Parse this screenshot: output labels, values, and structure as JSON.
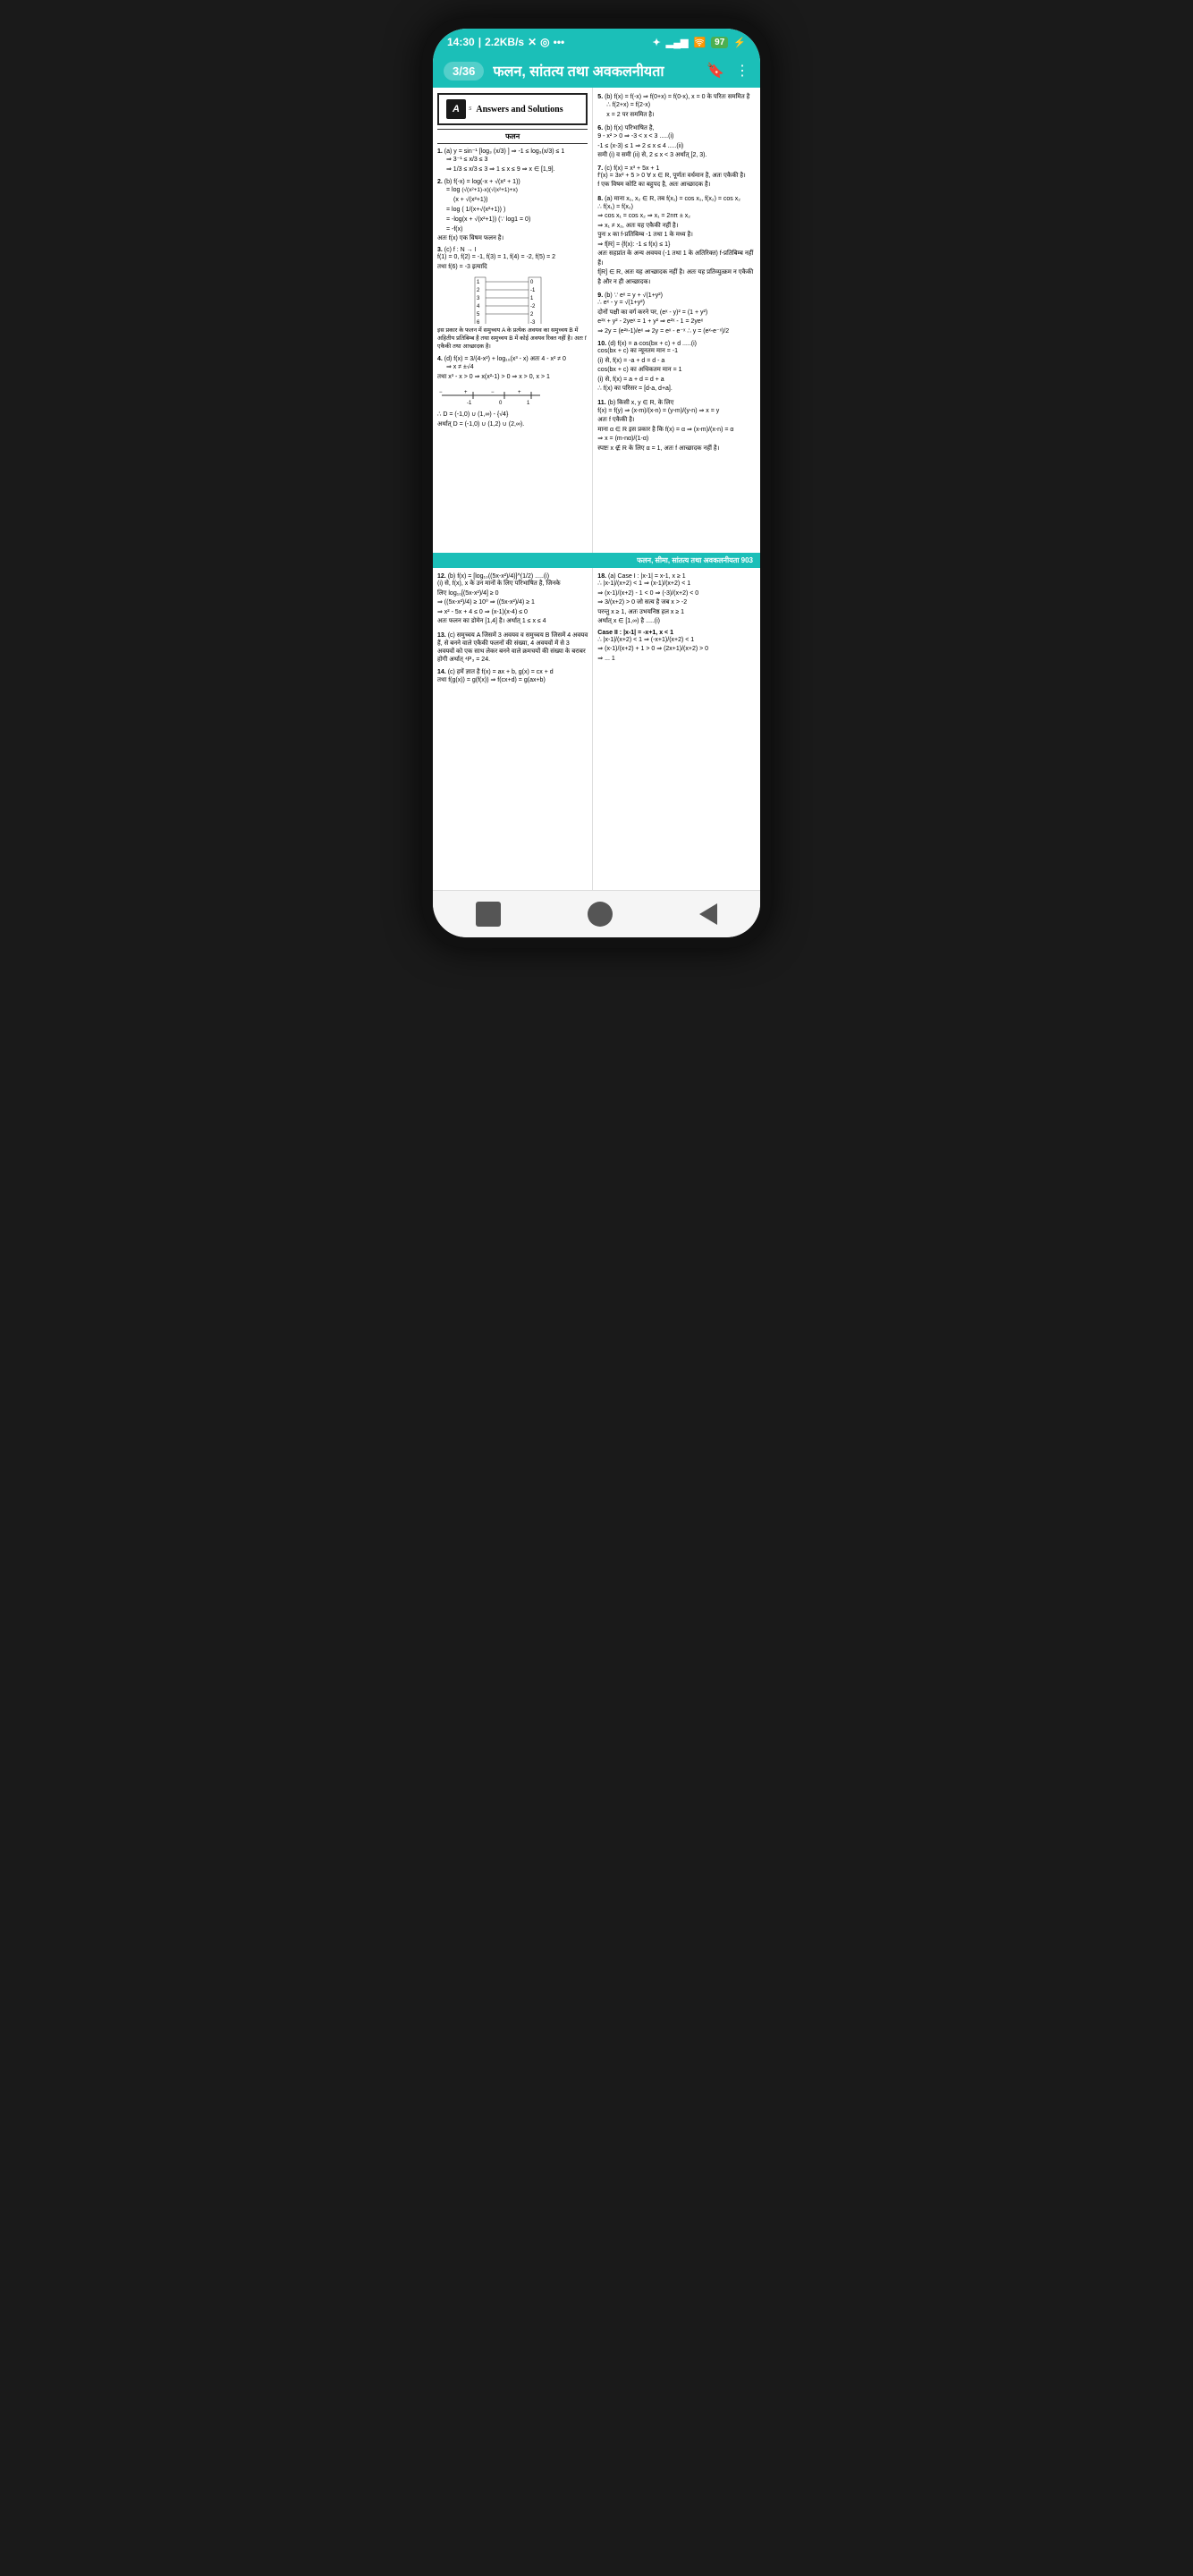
{
  "phone": {
    "status_bar": {
      "time": "14:30",
      "network": "2.2KB/s",
      "battery": "97"
    },
    "nav": {
      "page": "3/36",
      "title": "फलन, सांतत्य तथा अवकलनीयता",
      "bookmark_icon": "🔖",
      "menu_icon": "⋮"
    }
  },
  "page1": {
    "header": "Answers and Solutions",
    "section": "फलन",
    "problems": [
      {
        "num": "1.",
        "part": "(a)",
        "content": "y = sin⁻¹[log₃(x/3)] ⇒ -1 ≤ log₃(x/3) ≤ 1"
      },
      {
        "num": "2.",
        "part": "(b)",
        "content": "f(-x) = log(-x + √(x² + 1))"
      },
      {
        "num": "3.",
        "part": "(c)",
        "content": "f : N → I"
      },
      {
        "num": "4.",
        "part": "(d)",
        "content": "f(x) = 3/(4-x²) + log₁₀(x³ - x)"
      }
    ]
  },
  "page2": {
    "header": "फलन, सीमा, सांतत्य तथा अवकलनीयता 903",
    "problems": [
      {
        "num": "12.",
        "part": "(b)"
      },
      {
        "num": "13.",
        "part": "(c)"
      },
      {
        "num": "14.",
        "part": "(c)"
      },
      {
        "num": "18.",
        "part": "(a)"
      }
    ]
  },
  "bottom_nav": {
    "square_icon": "■",
    "circle_icon": "●",
    "back_icon": "◀"
  }
}
